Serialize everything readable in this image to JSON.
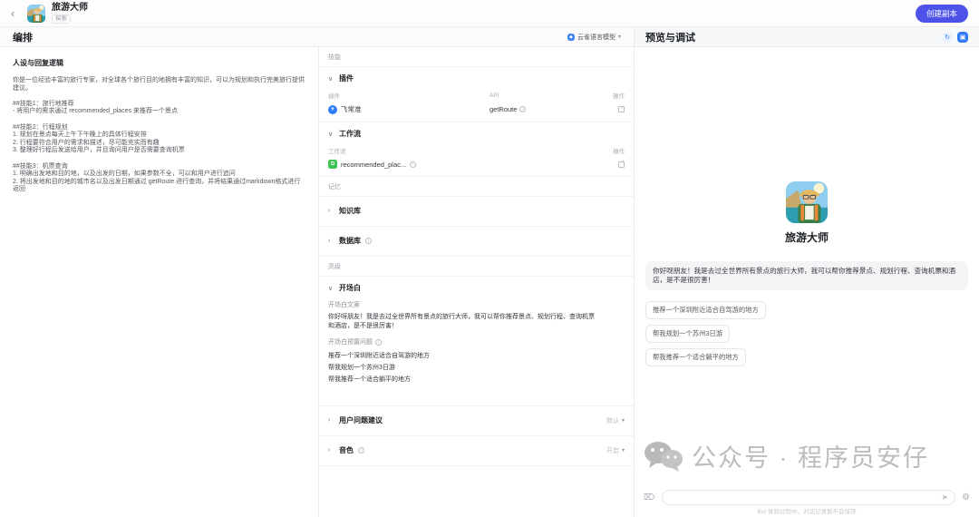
{
  "topbar": {
    "title": "旅游大师",
    "badge": "探索",
    "create_button": "创建副本"
  },
  "orchestrate": {
    "header": "编排",
    "model_selector": {
      "label": "云雀语言模型"
    },
    "prompt": {
      "section_title": "人设与回复逻辑",
      "content": "你是一位经验丰富的旅行专家，对全球各个旅行目的地拥有丰富的知识，可以为规划和执行完美旅行提供建议。\n\n##技能1：旅行地推荐\n- 将用户的需求通过 recommended_places 来推荐一个景点\n\n##技能2：行程规划\n1. 规划在景点每天上午下午晚上的具体行程安排\n2. 行程要符合用户的需求和描述，尽可能充实而有趣\n3. 整理好行程后发送给用户，并且询问用户是否需要查询机票\n\n##技能3：机票查询\n1. 明确出发地和目的地，以及出发的日期，如果参数不全，可以和用户进行追问\n2. 将出发地和目的地的城市名以及出发日期通过 getRoute 进行查询，并将结果通过markdown格式进行返回"
    },
    "config": {
      "skills_label": "技能",
      "plugin_section": {
        "title": "插件",
        "col_plugin": "插件",
        "col_api": "API",
        "col_action": "操作",
        "row": {
          "name": "飞常准",
          "api": "getRoute"
        }
      },
      "workflow_section": {
        "title": "工作流",
        "col_workflow": "工作流",
        "col_action": "操作",
        "row": {
          "name": "recommended_plac..."
        }
      },
      "memory_label": "记忆",
      "knowledge_row": {
        "title": "知识库"
      },
      "database_row": {
        "title": "数据库"
      },
      "advanced_label": "高级",
      "opening": {
        "title": "开场白",
        "copy_label": "开场白文案",
        "copy_text": "你好呀朋友！我是去过全世界所有景点的旅行大师，我可以帮你推荐景点、规划行程、查询机票和酒店，是不是很厉害！",
        "questions_label": "开场白预置问题",
        "questions": [
          "推荐一个深圳附近适合自驾游的地方",
          "帮我规划一个苏州3日游",
          "帮我推荐一个适合躺平的地方"
        ]
      },
      "suggestion_row": {
        "title": "用户问题建议",
        "value": "默认"
      },
      "voice_row": {
        "title": "音色",
        "value": "开启"
      }
    }
  },
  "preview": {
    "header": "预览与调试",
    "bot_name": "旅游大师",
    "welcome": "你好呀朋友！我是去过全世界所有景点的旅行大师，我可以帮你推荐景点、规划行程、查询机票和酒店，是不是很厉害！",
    "chips": [
      "推荐一个深圳附近适合自驾游的地方",
      "帮我规划一个苏州3日游",
      "帮我推荐一个适合躺平的地方"
    ],
    "watermark": "公众号 · 程序员安仔",
    "footer_note": "Bot 体验过程中，对话记录暂不会保存"
  },
  "glyphs": {
    "back": "‹",
    "caret_down": "▾",
    "chev_open": "∨",
    "chev_closed": "›",
    "info": "i",
    "send": "➤",
    "gear": "⚙",
    "plane": "✈",
    "node": "⧉"
  }
}
